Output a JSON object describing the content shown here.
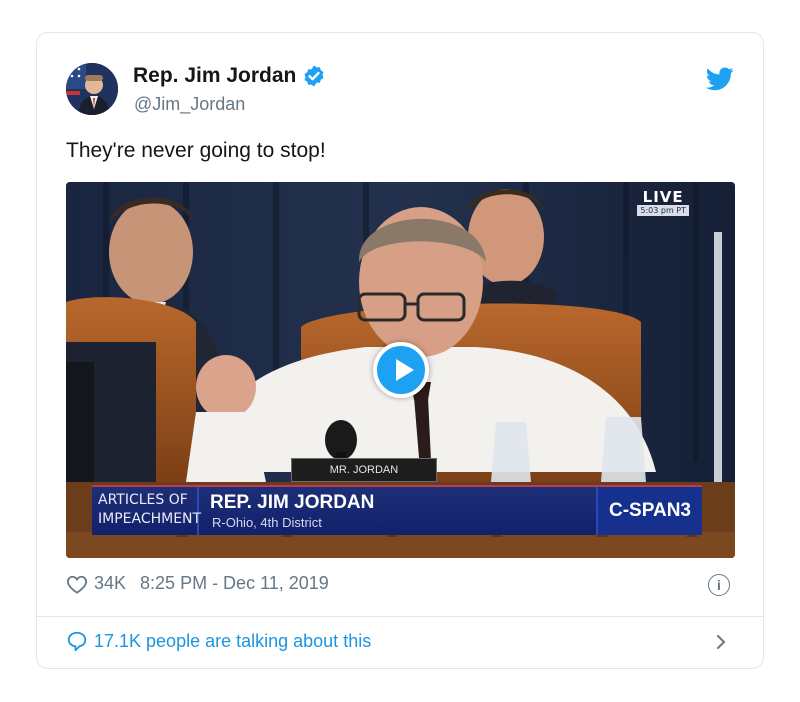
{
  "tweet": {
    "author_name": "Rep. Jim Jordan",
    "handle": "@Jim_Jordan",
    "text": "They're never going to stop!",
    "likes": "34K",
    "timestamp": "8:25 PM - Dec 11, 2019",
    "talking": "17.1K people are talking about this"
  },
  "video": {
    "live_label": "LIVE",
    "live_time": "5:03 pm PT",
    "nameplate": "MR. JORDAN",
    "lower_third_left_1": "ARTICLES OF",
    "lower_third_left_2": "IMPEACHMENT",
    "lower_third_name": "REP. JIM JORDAN",
    "lower_third_sub": "R-Ohio, 4th District",
    "brand": "C-SPAN3"
  },
  "colors": {
    "twitter_blue": "#1da1f2",
    "link_blue": "#1b95e0",
    "muted_gray": "#657786",
    "border": "#e1e8ed"
  },
  "icons": [
    "verified-badge-icon",
    "twitter-bird-icon",
    "play-icon",
    "heart-icon",
    "info-icon",
    "speech-bubble-icon",
    "chevron-right-icon"
  ]
}
